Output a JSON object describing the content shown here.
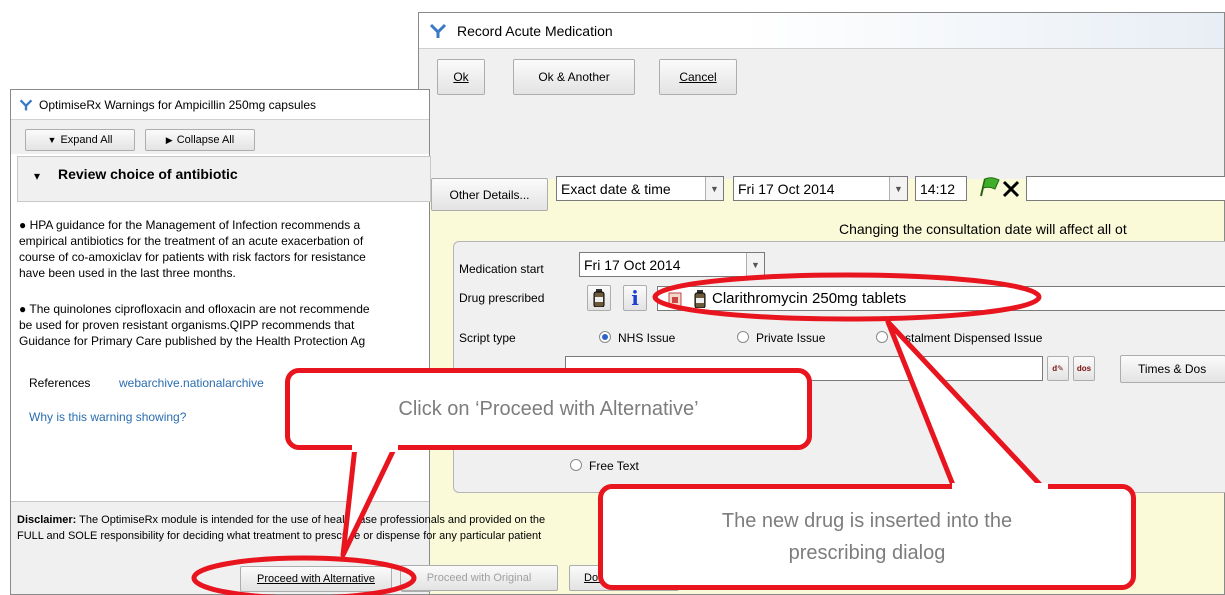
{
  "rx_window": {
    "title": "OptimiseRx Warnings for Ampicillin 250mg capsules",
    "expand_all": "Expand All",
    "collapse_all": "Collapse All",
    "section_title": "Review choice of antibiotic",
    "para1": [
      "HPA guidance for the Management of Infection recommends a",
      "empirical antibiotics for the treatment of an acute exacerbation of",
      "course of co-amoxiclav for patients with risk factors for resistance",
      "have been used in the last three months."
    ],
    "para2": [
      "The quinolones ciprofloxacin and ofloxacin are not recommende",
      "be used for proven resistant organisms.QIPP recommends that",
      "Guidance for Primary Care published by the Health Protection Ag"
    ],
    "references_label": "References",
    "references_link": "webarchive.nationalarchive",
    "why_link": "Why is this warning showing?",
    "disclaimer_bold": "Disclaimer:",
    "disclaimer_line1": "The OptimiseRx module is intended for the use of healthcase professionals and provided on the",
    "disclaimer_line2": "FULL and SOLE responsibility for deciding what treatment to prescribe or dispense for any particular patient",
    "proceed_alternative": "Proceed with Alternative",
    "proceed_original": "Proceed with Original",
    "do_not_prescribe": "Do Not Pr"
  },
  "acute_window": {
    "title": "Record Acute Medication",
    "ok": "Ok",
    "ok_another": "Ok & Another",
    "cancel": "Cancel",
    "other_details": "Other Details...",
    "date_mode": "Exact date & time",
    "date": "Fri 17 Oct 2014",
    "time": "14:12",
    "date_warning": "Changing the consultation date will affect all ot",
    "medication_start_label": "Medication start",
    "medication_start_value": "Fri 17 Oct 2014",
    "drug_prescribed_label": "Drug prescribed",
    "drug_value": "Clarithromycin 250mg tablets",
    "script_type_label": "Script type",
    "script_options": [
      "NHS Issue",
      "Private Issue",
      "Instalment Dispensed Issue"
    ],
    "times_dose": "Times & Dos",
    "free_text": "Free Text"
  },
  "callouts": {
    "proceed": "Click on ‘Proceed with Alternative’",
    "inserted_line1": "The new drug is inserted into the",
    "inserted_line2": "prescribing dialog"
  },
  "colors": {
    "annotation_red": "#e8141e",
    "link_blue": "#2a6db0",
    "radio_selected": "#2a64c8"
  }
}
